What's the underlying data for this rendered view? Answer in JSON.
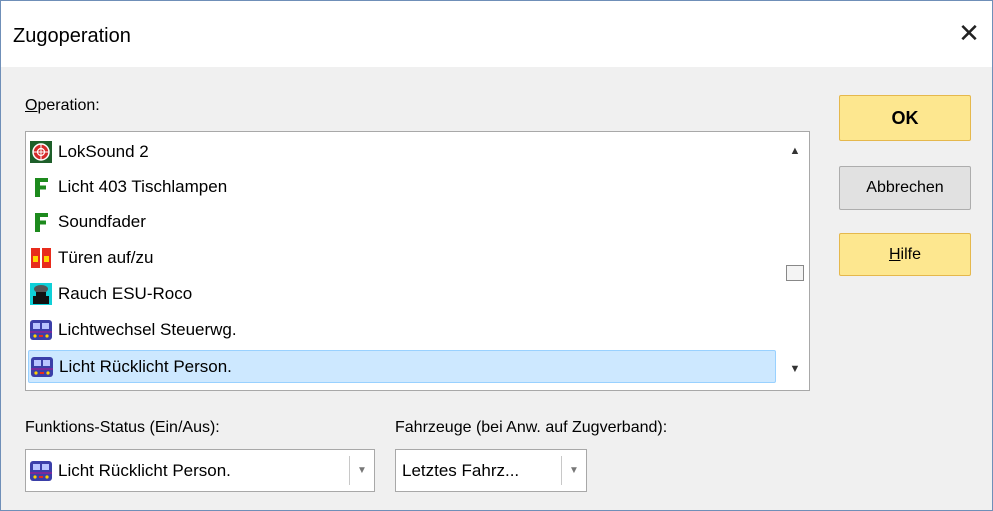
{
  "window": {
    "title": "Zugoperation",
    "close_glyph": "✕"
  },
  "operation": {
    "label_first": "O",
    "label_rest": "peration:",
    "items": [
      {
        "label": "LokSound 2",
        "icon": "loksound-icon"
      },
      {
        "label": "Licht 403 Tischlampen",
        "icon": "function-f-icon"
      },
      {
        "label": "Soundfader",
        "icon": "function-f-icon"
      },
      {
        "label": "Türen auf/zu",
        "icon": "doors-icon"
      },
      {
        "label": "Rauch ESU-Roco",
        "icon": "smoke-icon"
      },
      {
        "label": "Lichtwechsel Steuerwg.",
        "icon": "railcar-icon"
      },
      {
        "label": "Licht Rücklicht Person.",
        "icon": "railcar-icon",
        "selected": true
      }
    ]
  },
  "buttons": {
    "ok": "OK",
    "cancel": "Abbrechen",
    "help_first": "H",
    "help_rest": "ilfe"
  },
  "status": {
    "label": "Funktions-Status (Ein/Aus):",
    "value": "Licht Rücklicht Person."
  },
  "vehicles": {
    "label": "Fahrzeuge (bei Anw. auf Zugverband):",
    "value": "Letztes Fahrz..."
  },
  "colors": {
    "ok_button": "#fde78f",
    "selection": "#cde8ff",
    "icon_green": "#1d8a1d"
  }
}
